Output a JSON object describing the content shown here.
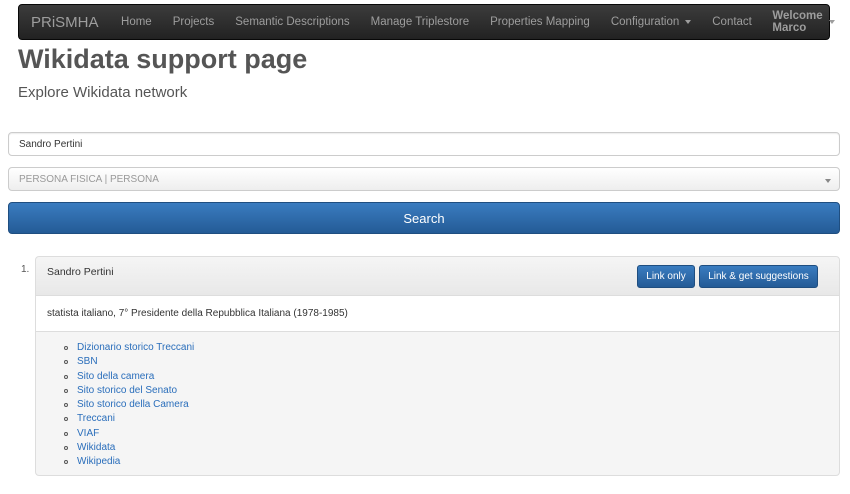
{
  "navbar": {
    "brand": "PRiSMHA",
    "items": [
      {
        "label": "Home"
      },
      {
        "label": "Projects"
      },
      {
        "label": "Semantic Descriptions"
      },
      {
        "label": "Manage Triplestore"
      },
      {
        "label": "Properties Mapping"
      },
      {
        "label": "Configuration"
      },
      {
        "label": "Contact"
      }
    ],
    "user": "Welcome Marco"
  },
  "header": {
    "title": "Wikidata support page",
    "subtitle": "Explore Wikidata network"
  },
  "form": {
    "search_value": "Sandro Pertini",
    "type_selected": "PERSONA FISICA | PERSONA",
    "search_label": "Search"
  },
  "result": {
    "index": "1.",
    "name": "Sandro Pertini",
    "link_only_label": "Link only",
    "link_suggest_label": "Link & get suggestions",
    "description": "statista italiano, 7° Presidente della Repubblica Italiana (1978-1985)",
    "links": [
      "Dizionario storico Treccani",
      "SBN",
      "Sito della camera",
      "Sito storico del Senato",
      "Sito storico della Camera",
      "Treccani",
      "VIAF",
      "Wikidata",
      "Wikipedia"
    ]
  },
  "colors": {
    "navbar_bg": "#222222",
    "primary_button": "#2d6cae",
    "link": "#2a6ebb"
  }
}
